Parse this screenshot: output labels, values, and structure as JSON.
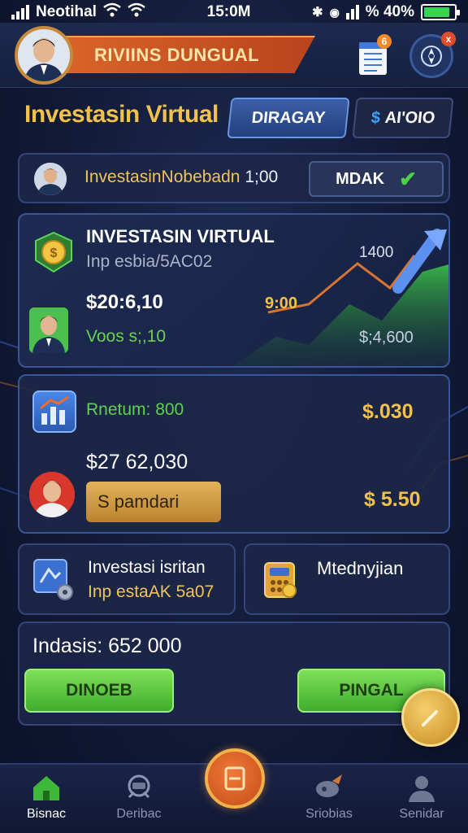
{
  "status_bar": {
    "carrier": "Neotihal",
    "time": "15:0M",
    "battery_percent": "% 40%",
    "battery_level": 0.85
  },
  "header": {
    "username": "RIVIINS DUNGUAL",
    "notification_badge": "6",
    "alert_badge": "x"
  },
  "title": {
    "text": "Investasin Virtual",
    "tabs": [
      {
        "label": "DIRAGAY"
      },
      {
        "label": "AI'OIO",
        "prefix": "$"
      }
    ]
  },
  "info_row": {
    "text": "InvestasinNobebadn",
    "value": "1;00",
    "button_label": "MDAK"
  },
  "investment_card": {
    "title": "INVESTASIN VIRTUAL",
    "subtitle": "Inp esbia/5AC02",
    "amount": "$20:6,10",
    "volume": "Voos s;,10",
    "chart_label_top": "1400",
    "chart_label_mid": "9:00",
    "chart_label_bottom": "$;4,600"
  },
  "return_card": {
    "label": "Rnetum: 800",
    "value_right_top": "$.030",
    "amount": "$27 62,030",
    "button_label": "S pamdari",
    "value_right_bottom": "$ 5.50"
  },
  "mini_left": {
    "line1": "Investasi isritan",
    "line2": "Inp estaAK 5a07"
  },
  "mini_right": {
    "line1": "Mtednyjian"
  },
  "balance": {
    "label": "Indasis: 652 000",
    "button_left": "DINOEB",
    "button_right": "PINGAL"
  },
  "bottom_nav": {
    "items": [
      {
        "label": "Bisnac",
        "icon": "home-icon"
      },
      {
        "label": "Deribac",
        "icon": "briefcase-icon"
      },
      {
        "label": "",
        "icon": "center-action-icon"
      },
      {
        "label": "Sriobias",
        "icon": "rocket-icon"
      },
      {
        "label": "Senidar",
        "icon": "profile-icon"
      }
    ]
  },
  "colors": {
    "accent_gold": "#f2c14b",
    "accent_green": "#5fd14e",
    "banner_orange": "#d9652a",
    "panel": "#1d2748"
  }
}
